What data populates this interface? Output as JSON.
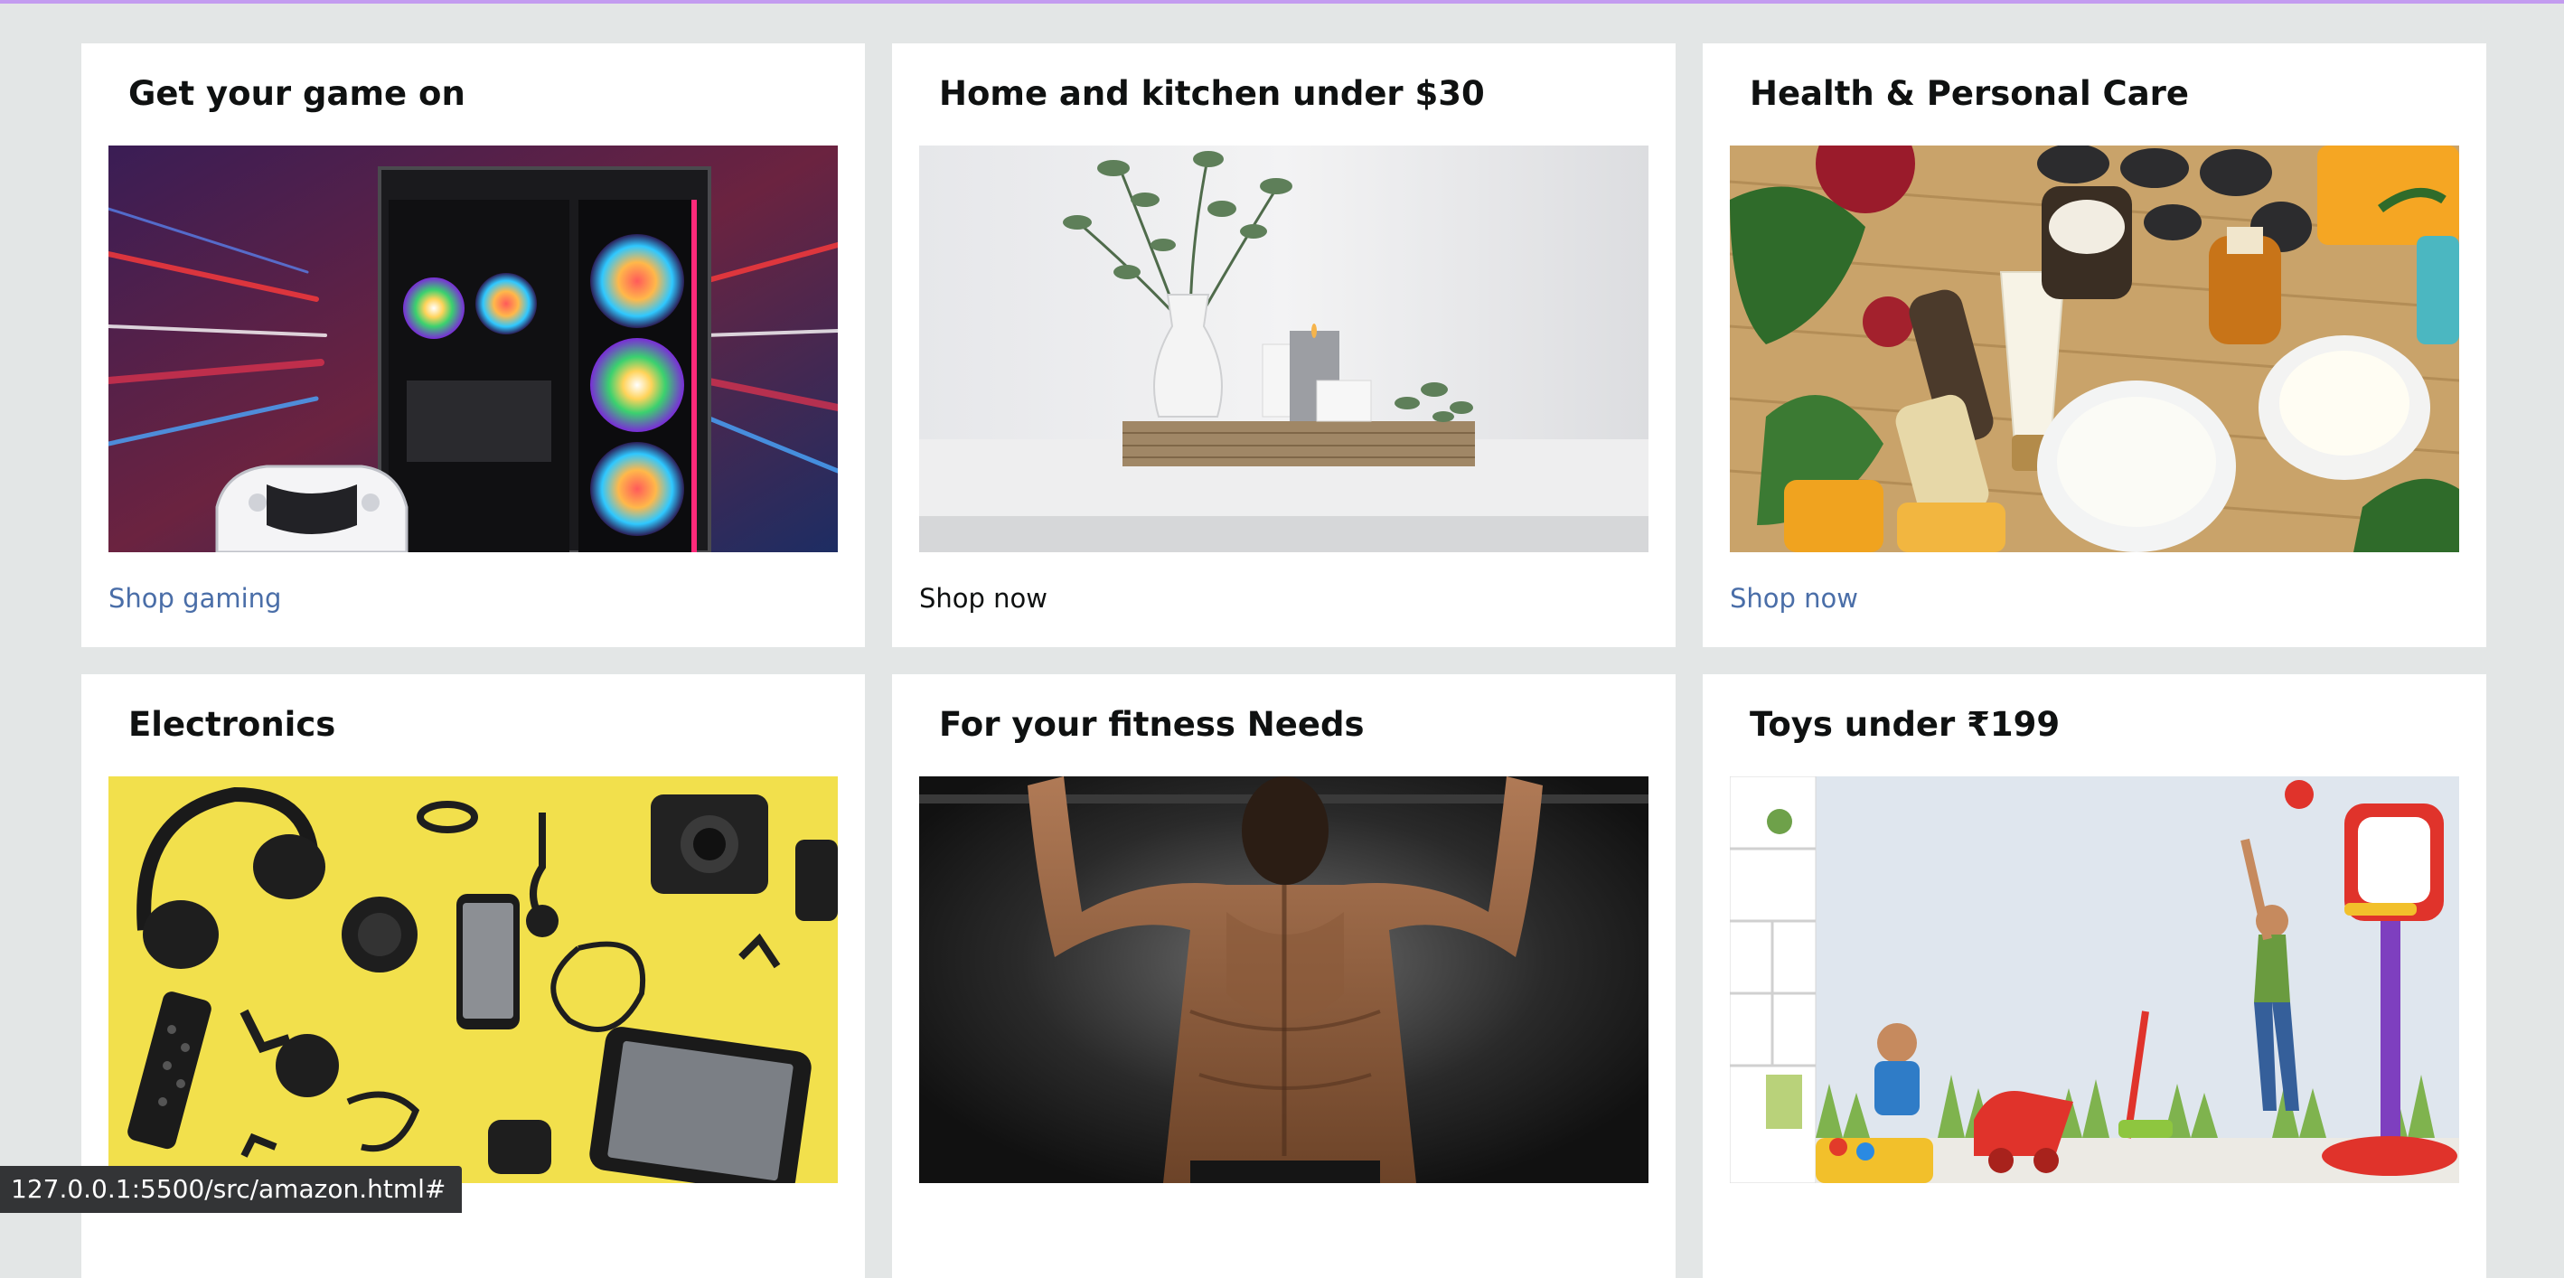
{
  "colors": {
    "page_background": "#e3e6e6",
    "card_background": "#ffffff",
    "link_blue": "#4a6ea8",
    "link_dark": "#0f1111",
    "top_accent": "#c39cf0"
  },
  "cards": [
    {
      "title": "Get your game on",
      "link": "Shop gaming",
      "link_color": "#4a6ea8"
    },
    {
      "title": "Home and kitchen under $30",
      "link": "Shop now",
      "link_color": "#0f1111"
    },
    {
      "title": "Health & Personal Care",
      "link": "Shop now",
      "link_color": "#4a6ea8"
    },
    {
      "title": "Electronics",
      "link": "",
      "link_color": "#4a6ea8"
    },
    {
      "title": "For your fitness Needs",
      "link": "",
      "link_color": "#4a6ea8"
    },
    {
      "title": "Toys under ₹199",
      "link": "",
      "link_color": "#4a6ea8"
    }
  ],
  "status_bar": {
    "url": "127.0.0.1:5500/src/amazon.html#"
  }
}
